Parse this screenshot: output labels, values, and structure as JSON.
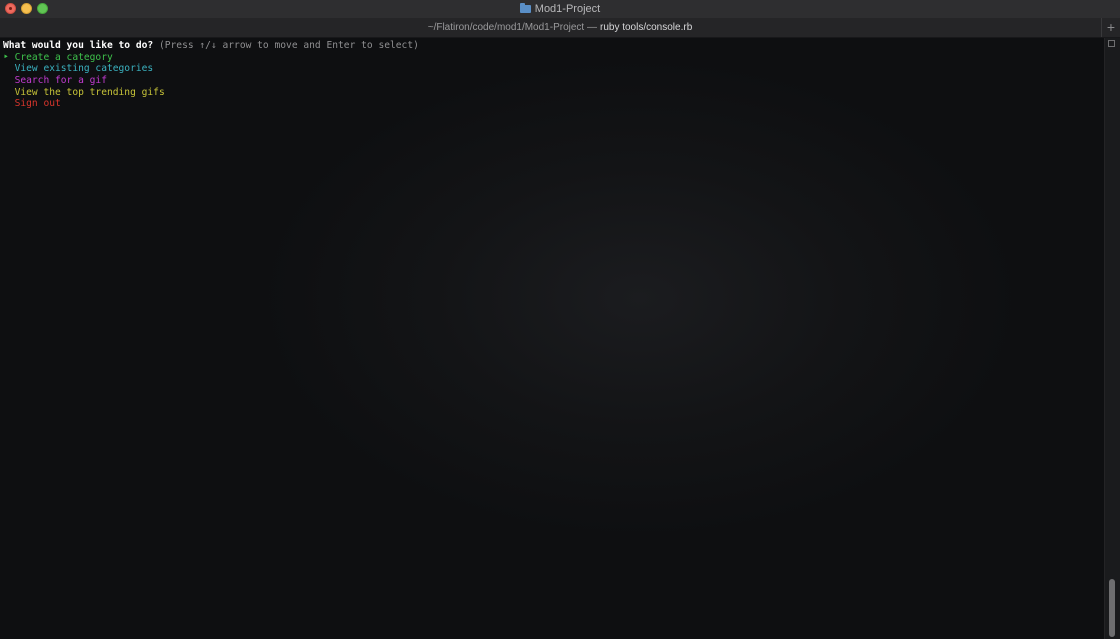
{
  "window": {
    "title": "Mod1-Project",
    "tab_path": "~/Flatiron/code/mod1/Mod1-Project —",
    "tab_command": "ruby tools/console.rb",
    "new_tab_label": "+"
  },
  "terminal": {
    "prompt_question": "What would you like to do?",
    "prompt_hint": "(Press ↑/↓ arrow to move and Enter to select)",
    "selection_marker": "‣",
    "options": [
      {
        "label": "Create a category",
        "color": "#3ec24c",
        "selected": true
      },
      {
        "label": "View existing categories",
        "color": "#3bb2c0",
        "selected": false
      },
      {
        "label": "Search for a gif",
        "color": "#c23bd0",
        "selected": false
      },
      {
        "label": "View the top trending gifs",
        "color": "#c6c338",
        "selected": false
      },
      {
        "label": "Sign out",
        "color": "#d8352c",
        "selected": false
      }
    ]
  },
  "icons": {
    "folder": "folder-icon",
    "close": "close-icon",
    "minimize": "minimize-icon",
    "zoom": "zoom-icon"
  }
}
